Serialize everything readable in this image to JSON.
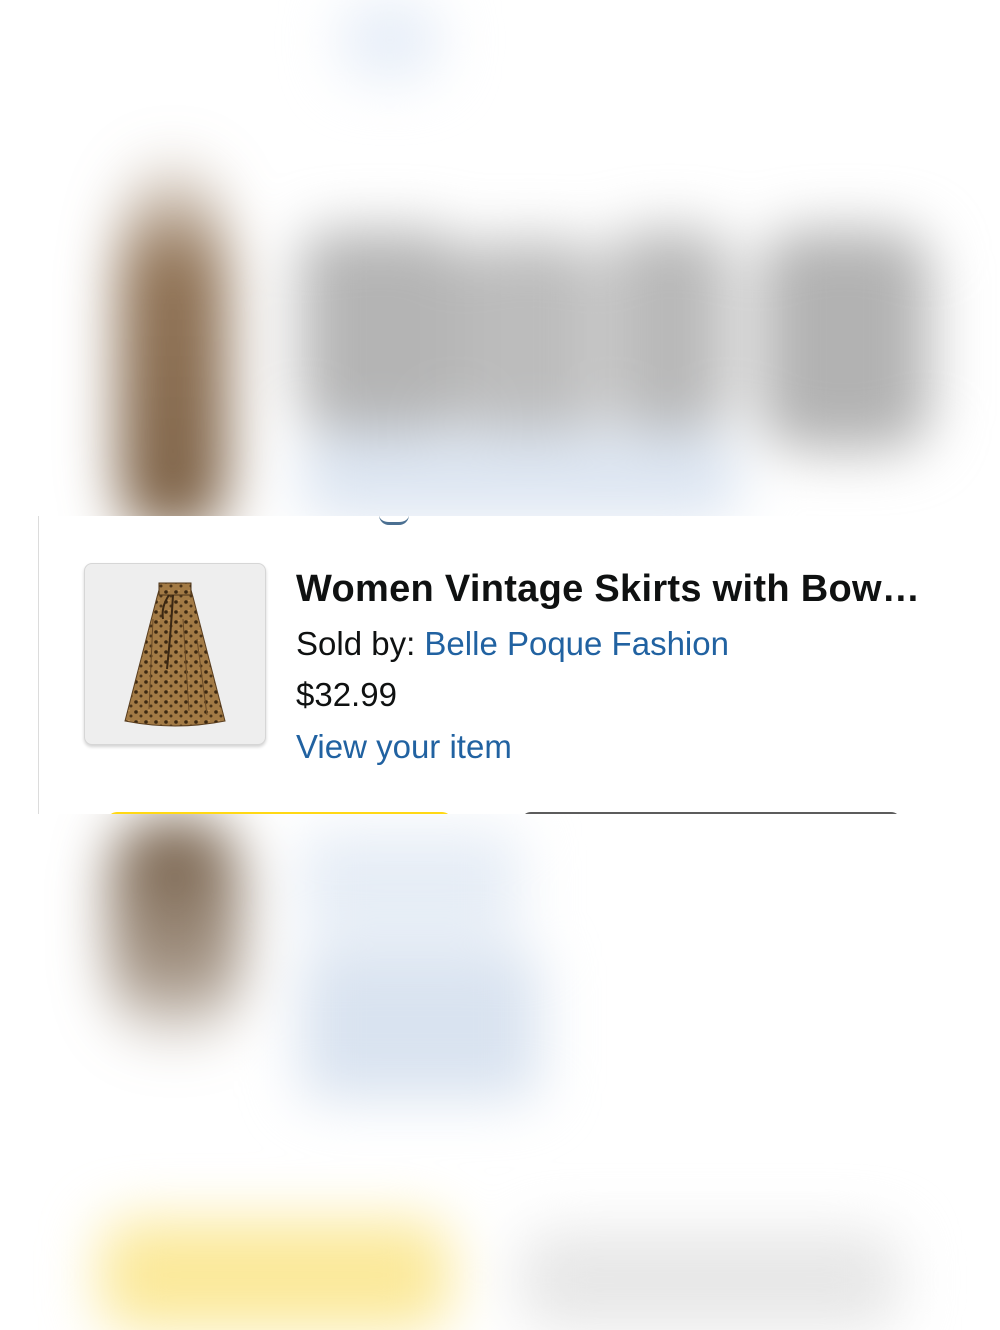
{
  "product": {
    "title": "Women Vintage Skirts with Bow…",
    "sold_by_label": "Sold by:",
    "seller_name": "Belle Poque Fashion",
    "price": "$32.99",
    "view_item_label": "View your item",
    "image_icon": "leopard-print-skirt"
  },
  "colors": {
    "link": "#2162a1",
    "text": "#0f1111",
    "primary_button": "#ffd814"
  }
}
